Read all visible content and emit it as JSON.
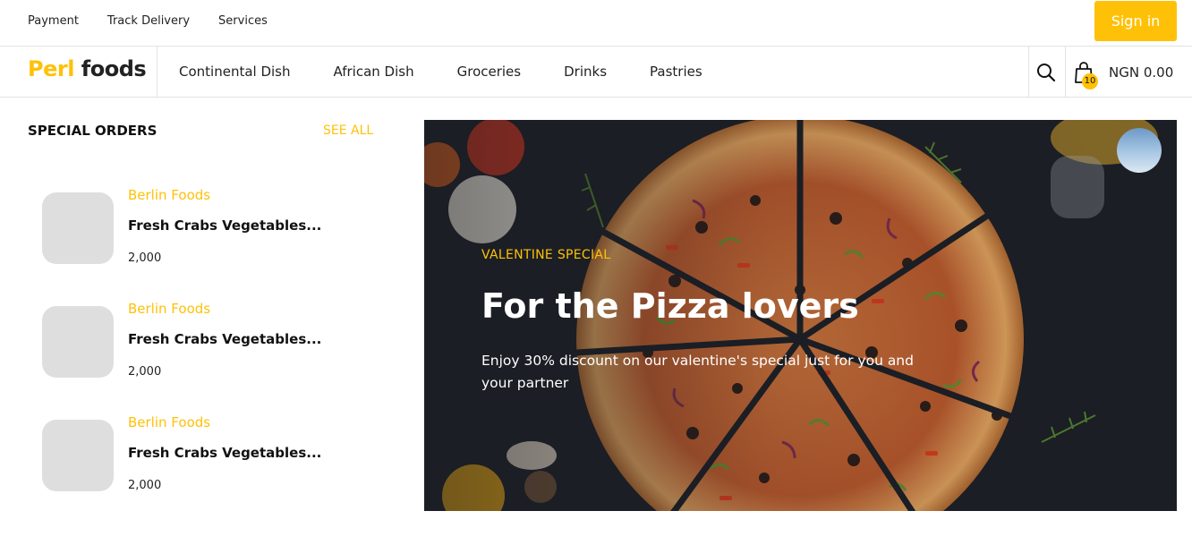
{
  "top_links": [
    "Payment",
    "Track Delivery",
    "Services"
  ],
  "sign_in": "Sign in",
  "logo": {
    "part1": "Perl",
    "part2": "foods"
  },
  "nav": [
    "Continental Dish",
    "African Dish",
    "Groceries",
    "Drinks",
    "Pastries"
  ],
  "cart": {
    "count": "10",
    "total": "NGN 0.00"
  },
  "special_orders": {
    "title": "SPECIAL ORDERS",
    "see_all": "SEE ALL",
    "items": [
      {
        "vendor": "Berlin Foods",
        "name": "Fresh Crabs Vegetables...",
        "price": "2,000"
      },
      {
        "vendor": "Berlin Foods",
        "name": "Fresh Crabs Vegetables...",
        "price": "2,000"
      },
      {
        "vendor": "Berlin Foods",
        "name": "Fresh Crabs Vegetables...",
        "price": "2,000"
      }
    ]
  },
  "hero": {
    "tag": "VALENTINE SPECIAL",
    "title": "For the Pizza lovers",
    "description": "Enjoy 30% discount on our valentine's special just for you and your partner"
  },
  "colors": {
    "accent": "#FFC107",
    "thumb": "#DEDEDE",
    "hero_bg": "#1B1E24"
  },
  "icons": [
    "search-icon",
    "shopping-bag-icon"
  ]
}
